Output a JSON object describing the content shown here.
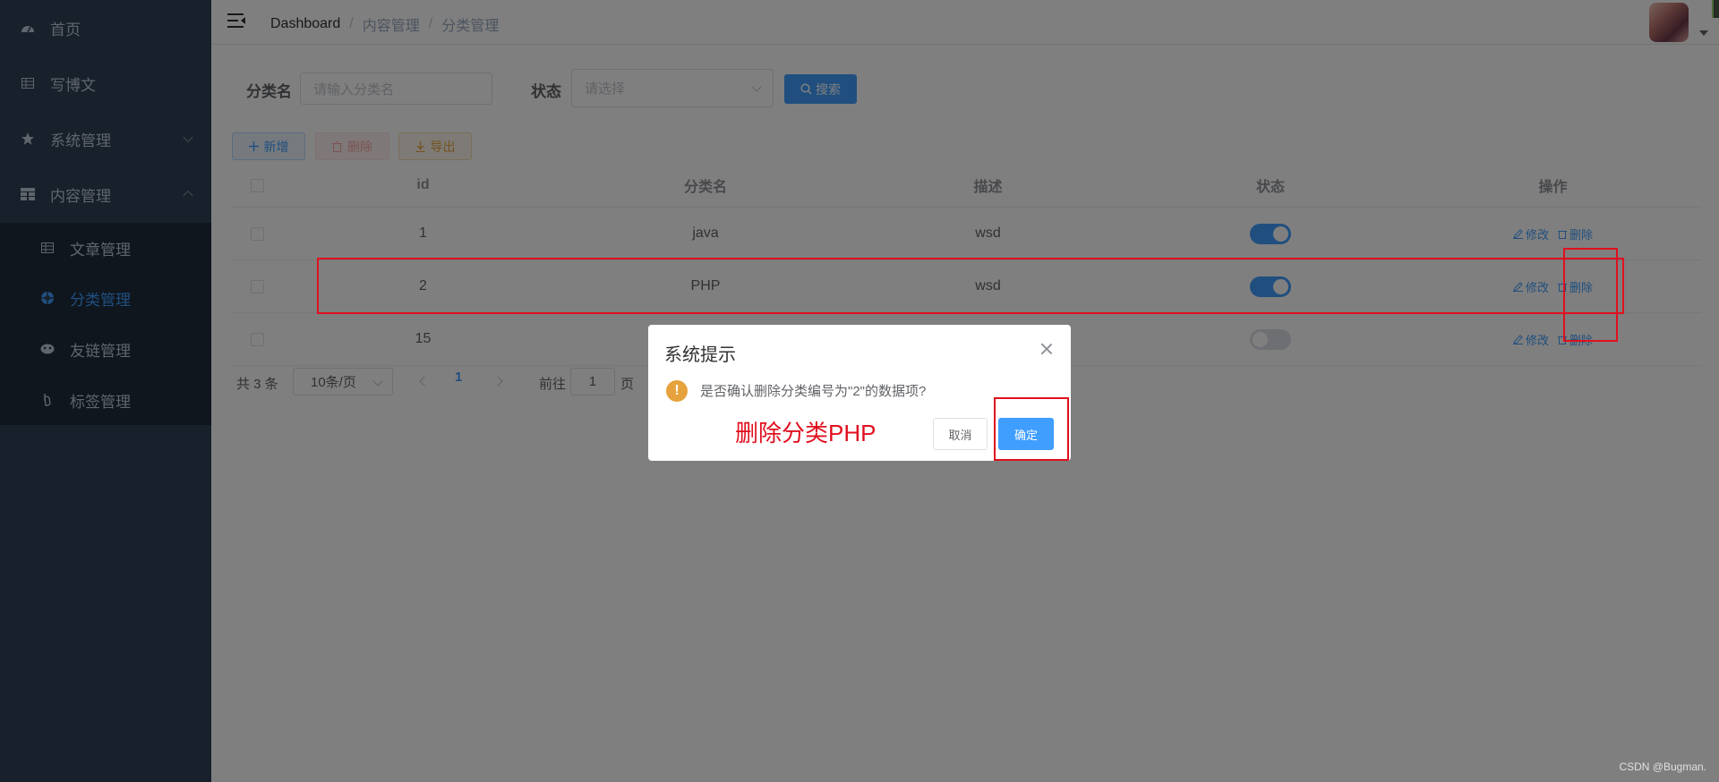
{
  "sidebar": {
    "items": [
      {
        "label": "首页",
        "icon": "dashboard-icon"
      },
      {
        "label": "写博文",
        "icon": "table-icon"
      },
      {
        "label": "系统管理",
        "icon": "star-icon",
        "arrow": "down"
      },
      {
        "label": "内容管理",
        "icon": "grid-icon",
        "arrow": "up"
      }
    ],
    "sub_items": [
      {
        "label": "文章管理",
        "icon": "table-icon"
      },
      {
        "label": "分类管理",
        "icon": "category-icon",
        "active": true
      },
      {
        "label": "友链管理",
        "icon": "link-icon"
      },
      {
        "label": "标签管理",
        "icon": "tag-icon"
      }
    ]
  },
  "breadcrumb": {
    "home": "Dashboard",
    "sep": "/",
    "level1": "内容管理",
    "level2": "分类管理"
  },
  "search": {
    "name_label": "分类名",
    "name_placeholder": "请输入分类名",
    "status_label": "状态",
    "status_placeholder": "请选择",
    "search_button": "搜索"
  },
  "toolbar": {
    "add": "新增",
    "delete": "删除",
    "export": "导出"
  },
  "table": {
    "headers": {
      "id": "id",
      "name": "分类名",
      "desc": "描述",
      "status": "状态",
      "ops": "操作"
    },
    "rows": [
      {
        "id": "1",
        "name": "java",
        "desc": "wsd",
        "status": true
      },
      {
        "id": "2",
        "name": "PHP",
        "desc": "wsd",
        "status": true
      },
      {
        "id": "15",
        "name": "",
        "desc": "",
        "status": false
      }
    ],
    "edit_label": "修改",
    "delete_label": "删除"
  },
  "pagination": {
    "total": "共 3 条",
    "page_size": "10条/页",
    "current": "1",
    "goto_label": "前往",
    "goto_value": "1",
    "page_suffix": "页"
  },
  "dialog": {
    "title": "系统提示",
    "message": "是否确认删除分类编号为\"2\"的数据项?",
    "annotation": "删除分类PHP",
    "cancel": "取消",
    "confirm": "确定"
  },
  "watermark": "CSDN @Bugman.",
  "colors": {
    "sidebar": "#304156",
    "primary": "#409eff",
    "annotation": "#e0101f",
    "warning": "#e6a23c"
  }
}
